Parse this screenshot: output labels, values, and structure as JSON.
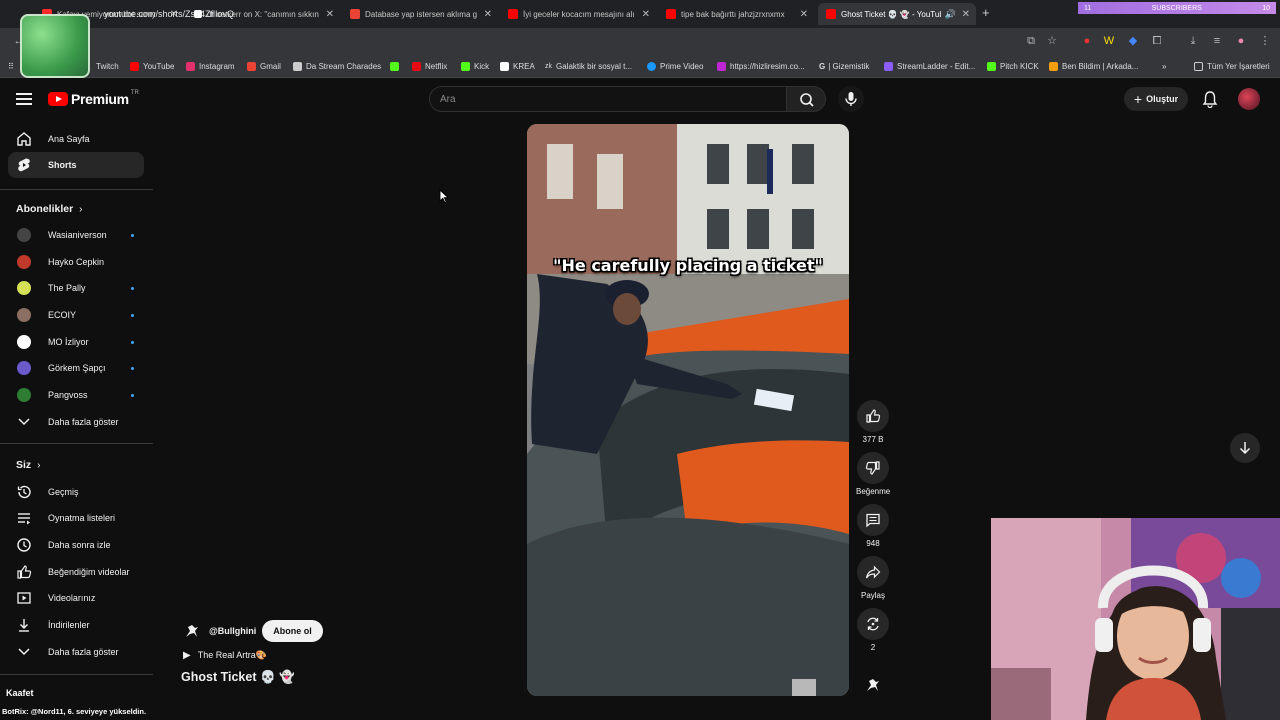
{
  "browser": {
    "tabs": [
      {
        "label": "Kafayı yemiyorum bot sanıy",
        "fav_color": "#ff2b2b",
        "active": false
      },
      {
        "label": "dr oetkerr on X: \"canımın sıkkın",
        "fav_color": "#ffffff",
        "active": false
      },
      {
        "label": "Database yap istersen aklıma g",
        "fav_color": "#ea4335",
        "active": false
      },
      {
        "label": "İyi geceler kocacım mesajını alı",
        "fav_color": "#ff0000",
        "active": false
      },
      {
        "label": "tipe bak bağırttı jahzjzrxnxmx",
        "fav_color": "#ff0000",
        "active": false
      },
      {
        "label": "Ghost Ticket 💀 👻 - YouTub",
        "fav_color": "#ff0000",
        "active": true
      }
    ],
    "subs_widget": {
      "left": "11",
      "label": "SUBSCRIBERS",
      "right": "10"
    },
    "url": "youtube.com/shorts/Zs74ZflIovQ",
    "bookmarks": [
      {
        "label": "Twitch",
        "color": "#9146ff"
      },
      {
        "label": "YouTube",
        "color": "#ff0000"
      },
      {
        "label": "Instagram",
        "color": "#e1306c"
      },
      {
        "label": "Gmail",
        "color": "#ea4335"
      },
      {
        "label": "Da Stream Charades",
        "color": "#cccccc"
      },
      {
        "label": "",
        "color": "#53fc18"
      },
      {
        "label": "Netflix",
        "color": "#e50914"
      },
      {
        "label": "Kick",
        "color": "#53fc18"
      },
      {
        "label": "KREA",
        "color": "#ffffff"
      },
      {
        "label": "Galaktik bir sosyal t...",
        "color": "#dddddd"
      },
      {
        "label": "Prime Video",
        "color": "#1a98ff"
      },
      {
        "label": "https://hizliresim.co...",
        "color": "#c026d3"
      },
      {
        "label": "| Gizemistik",
        "color": "#ffffff"
      },
      {
        "label": "StreamLadder - Edit...",
        "color": "#8b5cf6"
      },
      {
        "label": "Pitch KICK",
        "color": "#53fc18"
      },
      {
        "label": "Ben Bildim | Arkada...",
        "color": "#f59e0b"
      }
    ],
    "bookmarks_more": "»",
    "all_bookmarks": "Tüm Yer İşaretleri"
  },
  "header": {
    "logo_text": "Premium",
    "logo_region": "TR",
    "search_placeholder": "Ara",
    "create_label": "Oluştur"
  },
  "sidebar": {
    "main": [
      {
        "label": "Ana Sayfa",
        "icon": "home-icon"
      },
      {
        "label": "Shorts",
        "icon": "shorts-icon",
        "active": true
      }
    ],
    "subscriptions_title": "Abonelikler",
    "subscriptions": [
      {
        "label": "Wasianiverson",
        "color": "#444444",
        "dot": true
      },
      {
        "label": "Hayko Cepkin",
        "color": "#c0392b",
        "dot": false
      },
      {
        "label": "The Pally",
        "color": "#d4e157",
        "dot": true
      },
      {
        "label": "ECOIY",
        "color": "#8d6e63",
        "dot": true
      },
      {
        "label": "MO İzliyor",
        "color": "#ffffff",
        "dot": true
      },
      {
        "label": "Görkem Şapçı",
        "color": "#6a5acd",
        "dot": true
      },
      {
        "label": "Pangvoss",
        "color": "#2e7d32",
        "dot": true
      }
    ],
    "show_more": "Daha fazla göster",
    "you_title": "Siz",
    "you_items": [
      {
        "label": "Geçmiş",
        "icon": "history-icon"
      },
      {
        "label": "Oynatma listeleri",
        "icon": "playlists-icon"
      },
      {
        "label": "Daha sonra izle",
        "icon": "watch-later-icon"
      },
      {
        "label": "Beğendiğim videolar",
        "icon": "liked-videos-icon"
      },
      {
        "label": "Videolarınız",
        "icon": "your-videos-icon"
      },
      {
        "label": "İndirilenler",
        "icon": "downloads-icon"
      },
      {
        "label": "Daha fazla göster",
        "icon": "chevron-down-icon"
      }
    ]
  },
  "short": {
    "caption": "\"He carefully placing a ticket\"",
    "likes": "377 B",
    "dislike_label": "Beğenme",
    "comments": "948",
    "share_label": "Paylaş",
    "remix_count": "2",
    "channel": "@Bullghini",
    "subscribe_label": "Abone ol",
    "music": "The Real Artra🎨",
    "title": "Ghost Ticket 💀 👻"
  },
  "stream_overlay": {
    "chat_user": "Kaafet",
    "chat_message": "BotRix: @Nord11, 6. seviyeye yükseldin."
  }
}
